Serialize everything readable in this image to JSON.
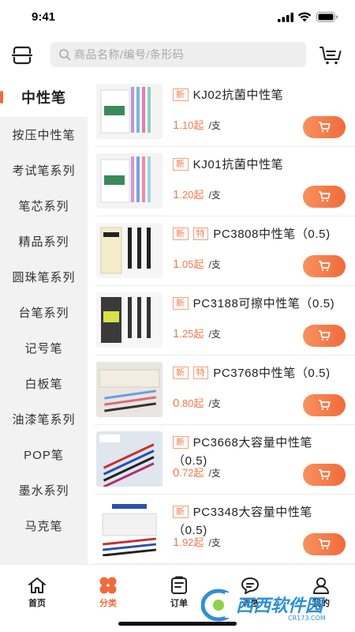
{
  "status_bar": {
    "time": "9:41"
  },
  "search": {
    "placeholder": "商品名称/编号/条形码"
  },
  "sidebar": {
    "items": [
      {
        "label": "中性笔",
        "active": true
      },
      {
        "label": "按压中性笔"
      },
      {
        "label": "考试笔系列"
      },
      {
        "label": "笔芯系列"
      },
      {
        "label": "精品系列"
      },
      {
        "label": "圆珠笔系列"
      },
      {
        "label": "台笔系列"
      },
      {
        "label": "记号笔"
      },
      {
        "label": "白板笔"
      },
      {
        "label": "油漆笔系列"
      },
      {
        "label": "POP笔"
      },
      {
        "label": "墨水系列"
      },
      {
        "label": "马克笔"
      }
    ]
  },
  "products": [
    {
      "tags": [
        "新"
      ],
      "name": "KJ02抗菌中性笔",
      "price_int": "1",
      "price_dec": ".10",
      "suffix": "起",
      "unit": "/支"
    },
    {
      "tags": [
        "新"
      ],
      "name": "KJ01抗菌中性笔",
      "price_int": "1",
      "price_dec": ".20",
      "suffix": "起",
      "unit": "/支"
    },
    {
      "tags": [
        "新",
        "特"
      ],
      "name": "PC3808中性笔（0.5)",
      "price_int": "1",
      "price_dec": ".05",
      "suffix": "起",
      "unit": "/支"
    },
    {
      "tags": [
        "新"
      ],
      "name": "PC3188可擦中性笔（0.5)",
      "price_int": "1",
      "price_dec": ".25",
      "suffix": "起",
      "unit": "/支"
    },
    {
      "tags": [
        "新",
        "特"
      ],
      "name": "PC3768中性笔（0.5)",
      "price_int": "0",
      "price_dec": ".80",
      "suffix": "起",
      "unit": "/支"
    },
    {
      "tags": [
        "新"
      ],
      "name": "PC3668大容量中性笔（0.5)",
      "price_int": "0",
      "price_dec": ".72",
      "suffix": "起",
      "unit": "/支"
    },
    {
      "tags": [
        "新"
      ],
      "name": "PC3348大容量中性笔（0.5)",
      "price_int": "1",
      "price_dec": ".92",
      "suffix": "起",
      "unit": "/支"
    }
  ],
  "tabbar": {
    "items": [
      {
        "label": "首页",
        "icon": "home-icon"
      },
      {
        "label": "分类",
        "icon": "category-icon",
        "active": true
      },
      {
        "label": "订单",
        "icon": "order-icon"
      },
      {
        "label": "消息",
        "icon": "message-icon"
      },
      {
        "label": "我的",
        "icon": "user-icon"
      }
    ]
  },
  "watermark": {
    "text": "西西软件园",
    "sub": "CR173.COM"
  },
  "colors": {
    "accent": "#f26a3a",
    "sidebar_bg": "#f2f2f2",
    "search_bg": "#eeeeee"
  }
}
